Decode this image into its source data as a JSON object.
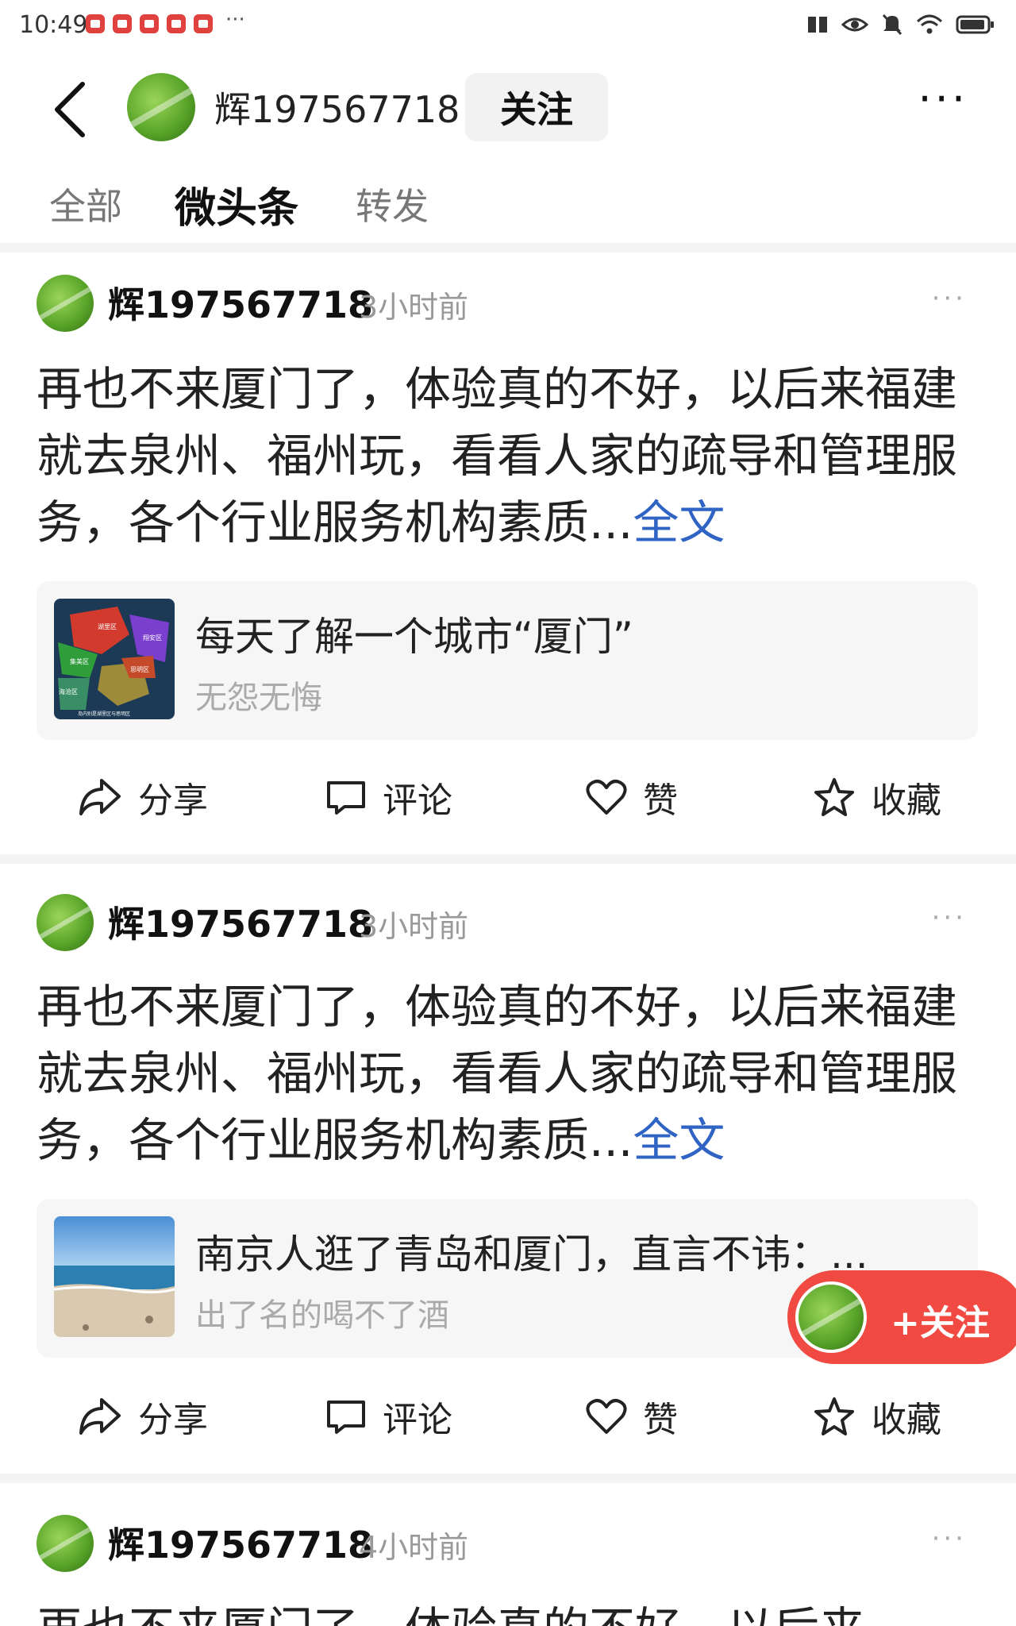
{
  "status_bar": {
    "time": "10:49",
    "overflow": "···",
    "icons": [
      "notification-app-icon",
      "notification-app-icon",
      "notification-app-icon",
      "notification-app-icon",
      "notification-app-icon",
      "book-icon",
      "eye-icon",
      "mute-icon",
      "wifi-icon",
      "battery-icon"
    ]
  },
  "header": {
    "username": "辉197567718",
    "follow_label": "关注",
    "more_label": "···"
  },
  "tabs": [
    {
      "label": "全部",
      "active": false
    },
    {
      "label": "微头条",
      "active": true
    },
    {
      "label": "转发",
      "active": false
    }
  ],
  "posts": [
    {
      "author": "辉197567718",
      "time": "3小时前",
      "more": "···",
      "text": "再也不来厦门了，体验真的不好，以后来福建就去泉州、福州玩，看看人家的疏导和管理服务，各个行业服务机构素质...",
      "fulltext_label": "全文",
      "card_title": "每天了解一个城市“厦门”",
      "card_subtitle": "无怨无悔",
      "card_thumb": "xiamen-district-map-thumbnail",
      "map_labels": [
        "湖里区",
        "翔安区",
        "集美区",
        "海沧区",
        "思明区"
      ],
      "map_caption": "岛内别是湖里区与思明区"
    },
    {
      "author": "辉197567718",
      "time": "3小时前",
      "more": "···",
      "text": "再也不来厦门了，体验真的不好，以后来福建就去泉州、福州玩，看看人家的疏导和管理服务，各个行业服务机构素质...",
      "fulltext_label": "全文",
      "card_title": "南京人逛了青岛和厦门，直言不讳：...",
      "card_subtitle": "出了名的喝不了酒",
      "card_thumb": "beach-photo-thumbnail"
    },
    {
      "author": "辉197567718",
      "time": "4小时前",
      "more": "···",
      "text": "再也不来厦门了，体验真的不好，以后来"
    }
  ],
  "actions": {
    "share": "分享",
    "comment": "评论",
    "like": "赞",
    "favorite": "收藏"
  },
  "floating_follow": {
    "label": "+关注"
  },
  "colors": {
    "link_blue": "#2f63c4",
    "follow_red": "#f04a42",
    "muted_gray": "#999999",
    "notification_red": "#e0413e"
  }
}
